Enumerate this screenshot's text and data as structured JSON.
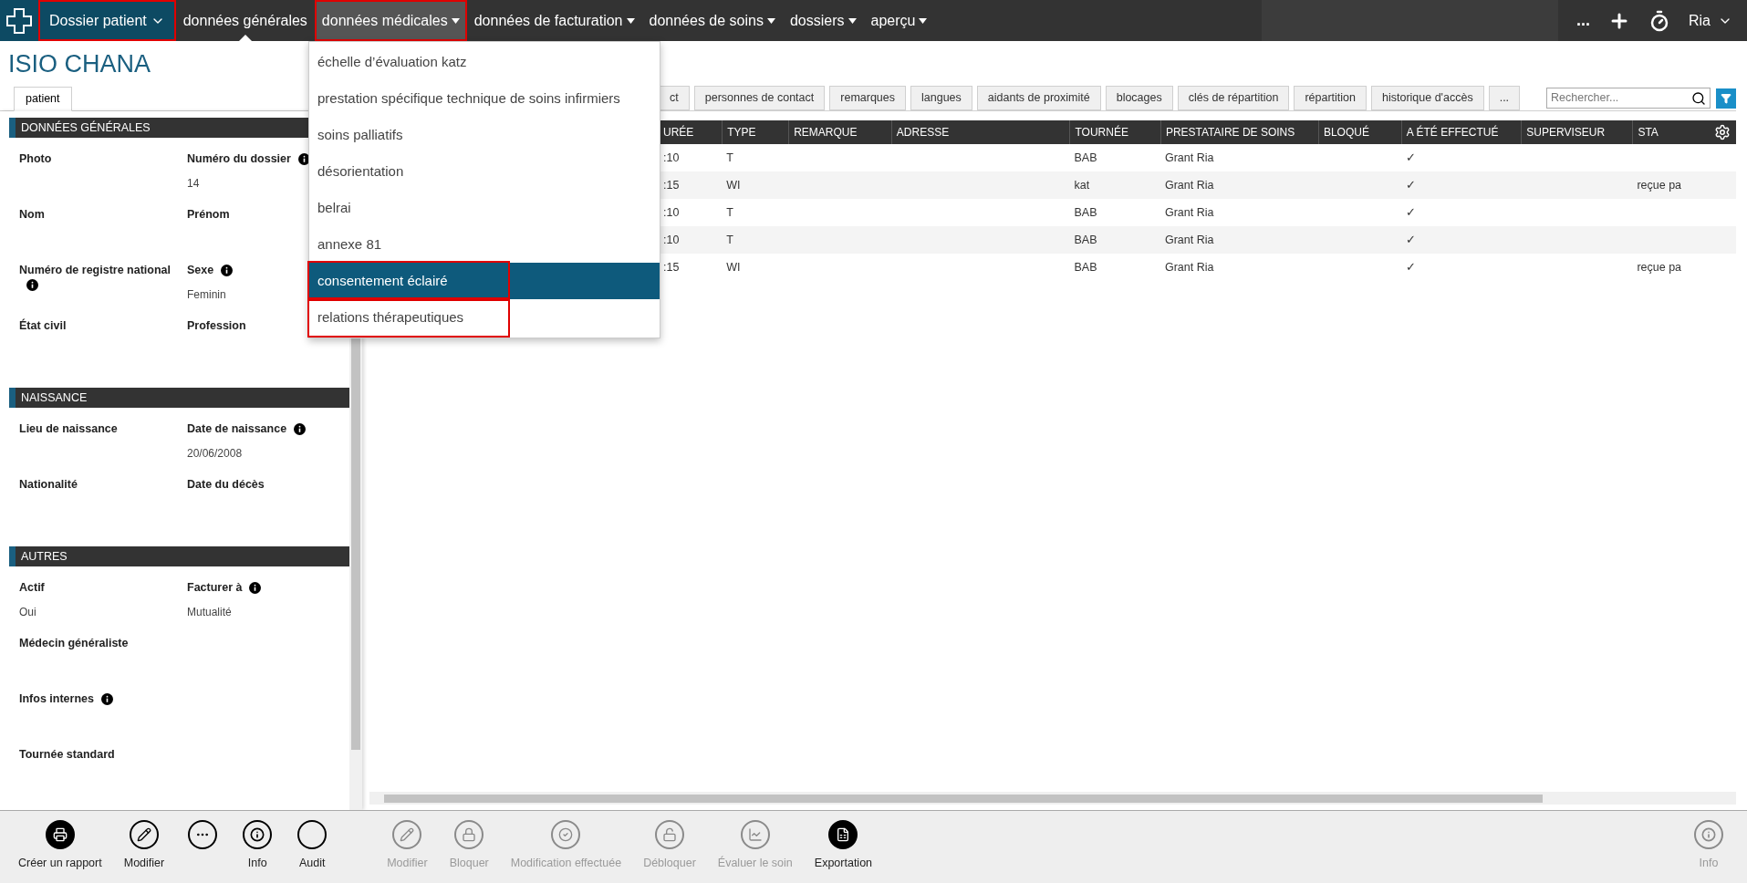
{
  "nav": {
    "items": [
      {
        "label": "Dossier patient",
        "kind": "module",
        "current": false,
        "open": false,
        "annotated": true
      },
      {
        "label": "données générales",
        "kind": "link",
        "current": true,
        "open": false,
        "annotated": false
      },
      {
        "label": "données médicales",
        "kind": "menu",
        "current": false,
        "open": true,
        "annotated": true
      },
      {
        "label": "données de facturation",
        "kind": "menu",
        "current": false,
        "open": false,
        "annotated": false
      },
      {
        "label": "données de soins",
        "kind": "menu",
        "current": false,
        "open": false,
        "annotated": false
      },
      {
        "label": "dossiers",
        "kind": "menu",
        "current": false,
        "open": false,
        "annotated": false
      },
      {
        "label": "aperçu",
        "kind": "menu",
        "current": false,
        "open": false,
        "annotated": false
      }
    ],
    "more": "...",
    "user": "Ria"
  },
  "dropdown": {
    "items": [
      {
        "label": "échelle d’évaluation katz",
        "selected": false,
        "annotated": false
      },
      {
        "label": "prestation spécifique technique de soins infirmiers",
        "selected": false,
        "annotated": false
      },
      {
        "label": "soins palliatifs",
        "selected": false,
        "annotated": false
      },
      {
        "label": "désorientation",
        "selected": false,
        "annotated": false
      },
      {
        "label": "belrai",
        "selected": false,
        "annotated": false
      },
      {
        "label": "annexe 81",
        "selected": false,
        "annotated": false
      },
      {
        "label": "consentement éclairé",
        "selected": true,
        "annotated": true
      },
      {
        "label": "relations thérapeutiques",
        "selected": false,
        "annotated": true
      }
    ]
  },
  "title": "ISIO CHANA",
  "left_tabs": [
    {
      "label": "patient",
      "selected": true
    }
  ],
  "sections": [
    {
      "title": "DONNÉES GÉNÉRALES",
      "rows": [
        [
          {
            "label": "Photo",
            "info": false
          },
          {
            "label": "Numéro du dossier",
            "info": true,
            "value": "14"
          }
        ],
        [
          {
            "label": "Nom",
            "info": false
          },
          {
            "label": "Prénom",
            "info": false
          }
        ],
        [
          {
            "label": "Numéro de registre national",
            "info": true
          },
          {
            "label": "Sexe",
            "info": true,
            "value": "Feminin"
          }
        ],
        [
          {
            "label": "État civil",
            "info": false
          },
          {
            "label": "Profession",
            "info": false
          }
        ]
      ]
    },
    {
      "title": "NAISSANCE",
      "rows": [
        [
          {
            "label": "Lieu de naissance",
            "info": false
          },
          {
            "label": "Date de naissance",
            "info": true,
            "value": "20/06/2008"
          }
        ],
        [
          {
            "label": "Nationalité",
            "info": false
          },
          {
            "label": "Date du décès",
            "info": false
          }
        ]
      ]
    },
    {
      "title": "AUTRES",
      "rows": [
        [
          {
            "label": "Actif",
            "info": false,
            "value": "Oui"
          },
          {
            "label": "Facturer à",
            "info": true,
            "value": "Mutualité"
          }
        ],
        [
          {
            "label": "Médecin généraliste",
            "info": false
          }
        ],
        [
          {
            "label": "Infos internes",
            "info": true
          }
        ],
        [
          {
            "label": "Tournée standard",
            "info": false
          }
        ]
      ]
    }
  ],
  "right_tabs": [
    {
      "label": "ct",
      "selected": false
    },
    {
      "label": "personnes de contact",
      "selected": false
    },
    {
      "label": "remarques",
      "selected": false
    },
    {
      "label": "langues",
      "selected": false
    },
    {
      "label": "aidants de proximité",
      "selected": false
    },
    {
      "label": "blocages",
      "selected": false
    },
    {
      "label": "clés de répartition",
      "selected": false
    },
    {
      "label": "répartition",
      "selected": false
    },
    {
      "label": "historique d'accès",
      "selected": false
    },
    {
      "label": "...",
      "selected": false
    }
  ],
  "search": {
    "placeholder": "Rechercher..."
  },
  "table": {
    "columns": [
      "URÉE",
      "TYPE",
      "REMARQUE",
      "ADRESSE",
      "TOURNÉE",
      "PRESTATAIRE DE SOINS",
      "BLOQUÉ",
      "A ÉTÉ EFFECTUÉ",
      "SUPERVISEUR",
      "STA"
    ],
    "rows": [
      [
        ":10",
        "T",
        "",
        "",
        "BAB",
        "Grant Ria",
        "",
        "✓",
        "",
        ""
      ],
      [
        ":15",
        "WI",
        "",
        "",
        "kat",
        "Grant Ria",
        "",
        "✓",
        "",
        "reçue pa"
      ],
      [
        ":10",
        "T",
        "",
        "",
        "BAB",
        "Grant Ria",
        "",
        "✓",
        "",
        ""
      ],
      [
        ":10",
        "T",
        "",
        "",
        "BAB",
        "Grant Ria",
        "",
        "✓",
        "",
        ""
      ],
      [
        ":15",
        "WI",
        "",
        "",
        "BAB",
        "Grant Ria",
        "",
        "✓",
        "",
        "reçue pa"
      ]
    ]
  },
  "toolbar": {
    "left": [
      {
        "label": "Créer un rapport",
        "disabled": false
      },
      {
        "label": "Modifier",
        "disabled": false
      },
      {
        "disabled": false
      },
      {
        "label": "Info",
        "disabled": false
      },
      {
        "label": "Audit",
        "disabled": false
      },
      {
        "label": "Modifier",
        "disabled": true
      },
      {
        "label": "Bloquer",
        "disabled": true
      },
      {
        "label": "Modification effectuée",
        "disabled": true
      },
      {
        "label": "Débloquer",
        "disabled": true
      },
      {
        "label": "Évaluer le soin",
        "disabled": true
      },
      {
        "label": "Exportation",
        "disabled": false
      }
    ],
    "right": [
      {
        "label": "Info",
        "disabled": true
      }
    ]
  }
}
